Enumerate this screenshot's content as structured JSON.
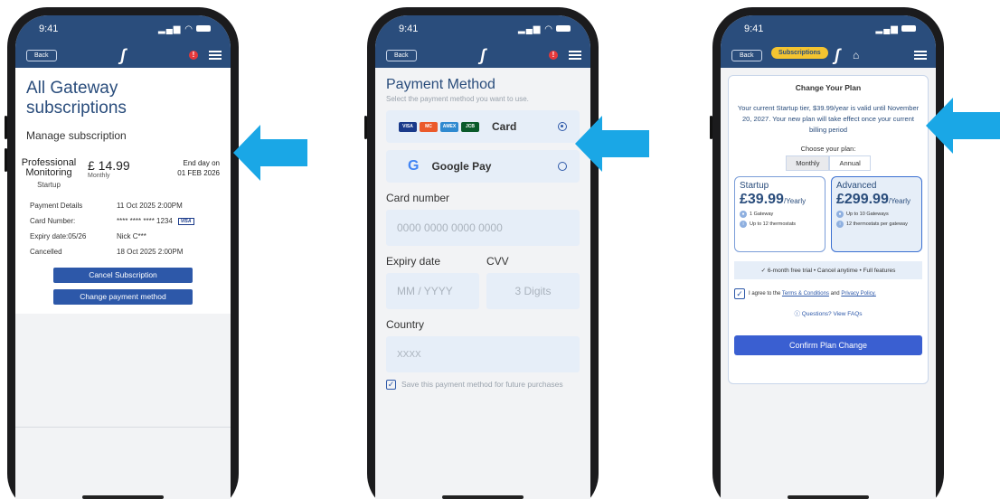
{
  "status": {
    "time": "9:41"
  },
  "common": {
    "back_label": "Back",
    "alert": "!"
  },
  "screen1": {
    "title": "All Gateway subscriptions",
    "subtitle": "Manage subscription",
    "plan_name": "Professional Monitoring",
    "plan_tier": "Startup",
    "price": "£ 14.99",
    "period": "Monthly",
    "end_label": "End day on",
    "end_date": "01 FEB 2026",
    "rows": [
      {
        "k": "Payment Details",
        "v": "11 Oct 2025 2:00PM"
      },
      {
        "k": "Card Number:",
        "v": "**** **** **** 1234"
      },
      {
        "k": "Expiry date:05/26",
        "v": "Nick C***"
      },
      {
        "k": "Cancelled",
        "v": "18 Oct 2025 2:00PM"
      }
    ],
    "visa": "VISA",
    "cancel_btn": "Cancel Subscription",
    "change_btn": "Change payment method"
  },
  "screen2": {
    "title": "Payment Method",
    "subtitle": "Select the payment method you want to use.",
    "card_label": "Card",
    "card_logos": [
      "VISA",
      "MC",
      "AMEX",
      "JCB"
    ],
    "gpay_label": "Google Pay",
    "card_number_label": "Card number",
    "card_number_ph": "0000 0000 0000 0000",
    "expiry_label": "Expiry date",
    "cvv_label": "CVV",
    "expiry_ph": "MM / YYYY",
    "cvv_ph": "3 Digits",
    "country_label": "Country",
    "country_ph": "XXXX",
    "save_text": "Save this payment method for future purchases"
  },
  "screen3": {
    "pill": "Subscriptions",
    "title": "Change Your Plan",
    "info": "Your current Startup tier, $39.99/year is valid until November 20, 2027. Your new plan will take effect once your current billing period",
    "choose": "Choose your plan:",
    "toggle": [
      "Monthly",
      "Annual"
    ],
    "plans": [
      {
        "name": "Startup",
        "price": "£39.99",
        "per": "/Yearly",
        "f1": "1 Gateway",
        "f2": "Up to 12 thermostats"
      },
      {
        "name": "Advanced",
        "price": "£299.99",
        "per": "/Yearly",
        "f1": "Up to 10 Gateways",
        "f2": "12 thermostats per gateway"
      }
    ],
    "banner": "✓ 6-month free trial • Cancel anytime • Full features",
    "agree_pre": "I agree to the ",
    "terms": "Terms & Conditions",
    "agree_mid": " and ",
    "privacy": "Privacy Policy.",
    "faq": "ⓘ Questions? View FAQs",
    "confirm": "Confirm Plan Change"
  },
  "colors": {
    "header": "#2a4d7c",
    "accent": "#2d58a9",
    "arrow": "#1aa7e6"
  }
}
